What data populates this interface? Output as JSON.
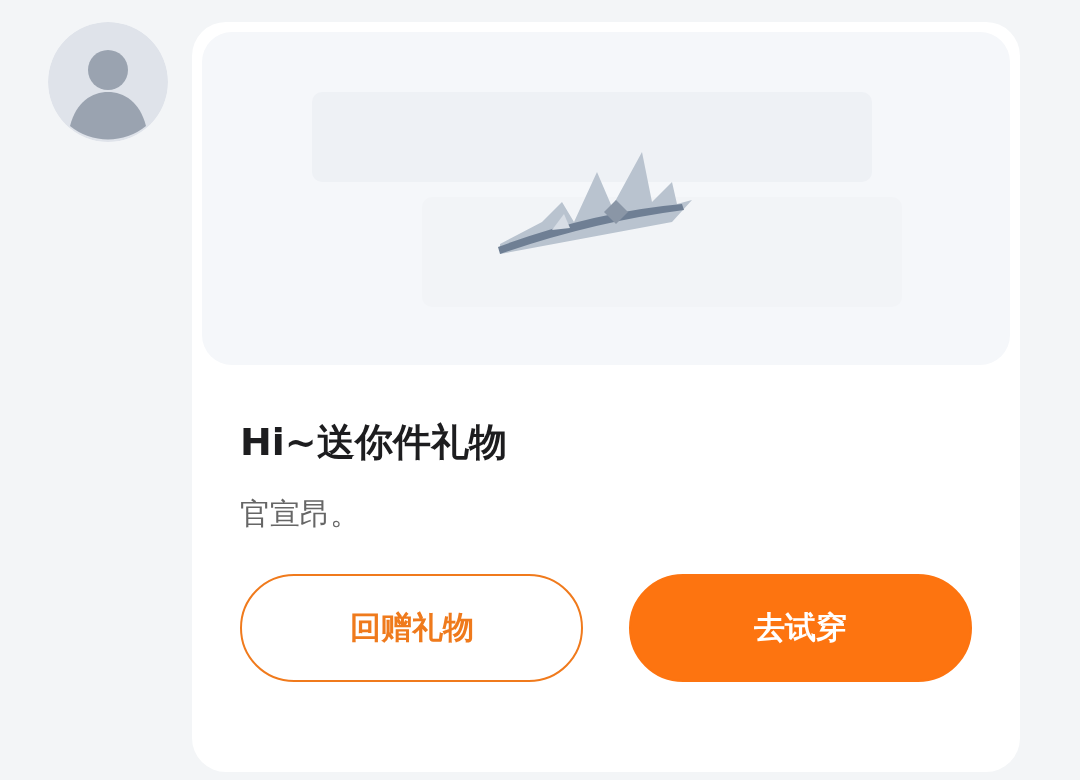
{
  "message": {
    "title": "Hi~送你件礼物",
    "text": "官宣昂。",
    "buttons": [
      {
        "label": "回赠礼物",
        "kind": "outline"
      },
      {
        "label": "去试穿",
        "kind": "filled"
      }
    ]
  }
}
